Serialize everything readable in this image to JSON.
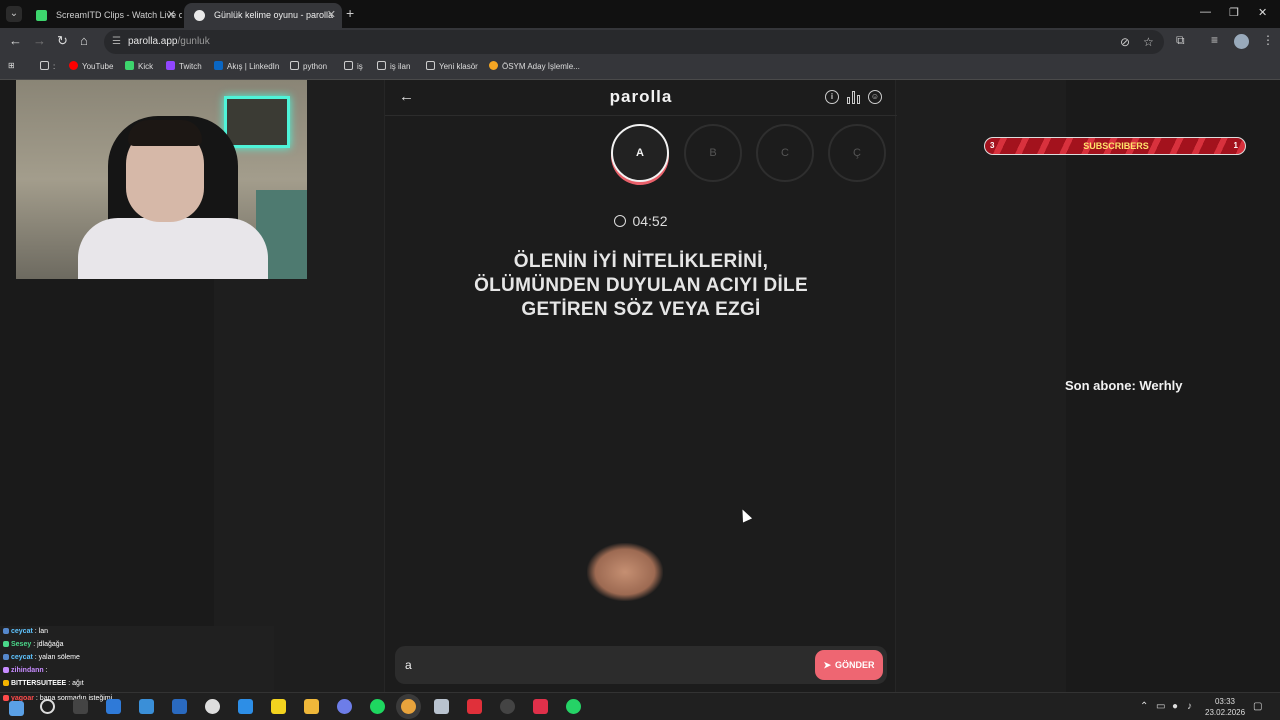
{
  "browser": {
    "tabs": [
      {
        "title": "ScreamITD Clips - Watch Live o",
        "close": "✕"
      },
      {
        "title": "Günlük kelime oyunu - parolla",
        "close": "✕"
      }
    ],
    "new_tab": "+",
    "url_host": "parolla.app",
    "url_path": "/gunluk",
    "bookmarks": [
      ":",
      "YouTube",
      "Kick",
      "Twitch",
      "Akış | LinkedIn",
      "python",
      "iş",
      "iş ilan",
      "Yeni klasör",
      "ÖSYM Aday İşlemle..."
    ]
  },
  "game": {
    "logo": "parolla",
    "letters": [
      "A",
      "B",
      "C",
      "Ç"
    ],
    "timer": "04:52",
    "question_lines": [
      "ÖLENİN İYİ NİTELİKLERİNİ,",
      "ÖLÜMÜNDEN DUYULAN ACIYI DİLE",
      "GETİREN SÖZ VEYA EZGİ"
    ],
    "answer_value": "a",
    "send_label": "GÖNDER"
  },
  "overlay": {
    "subs_left": "3",
    "subs_label": "SUBSCRIBERS",
    "subs_right": "1",
    "last_sub": "Son abone: Werhly"
  },
  "chat": [
    {
      "user": "ceycat",
      "msg": ": lan",
      "color": "#5fc4ff"
    },
    {
      "user": "Sesey",
      "msg": ": jdlağağa",
      "color": "#4ad88a"
    },
    {
      "user": "ceycat",
      "msg": ": yalan söleme",
      "color": "#5fc4ff"
    },
    {
      "user": "zihindann",
      "msg": ":",
      "color": "#c78bff"
    },
    {
      "user": "BITTERSUITEEE",
      "msg": ": ağıt",
      "color": "#ffffff"
    },
    {
      "user": "yagoar",
      "msg": ": bana sormadın isteğimi",
      "color": "#ff4b4b"
    }
  ],
  "taskbar": {
    "time": "03:33",
    "date": "23.02.2026"
  }
}
